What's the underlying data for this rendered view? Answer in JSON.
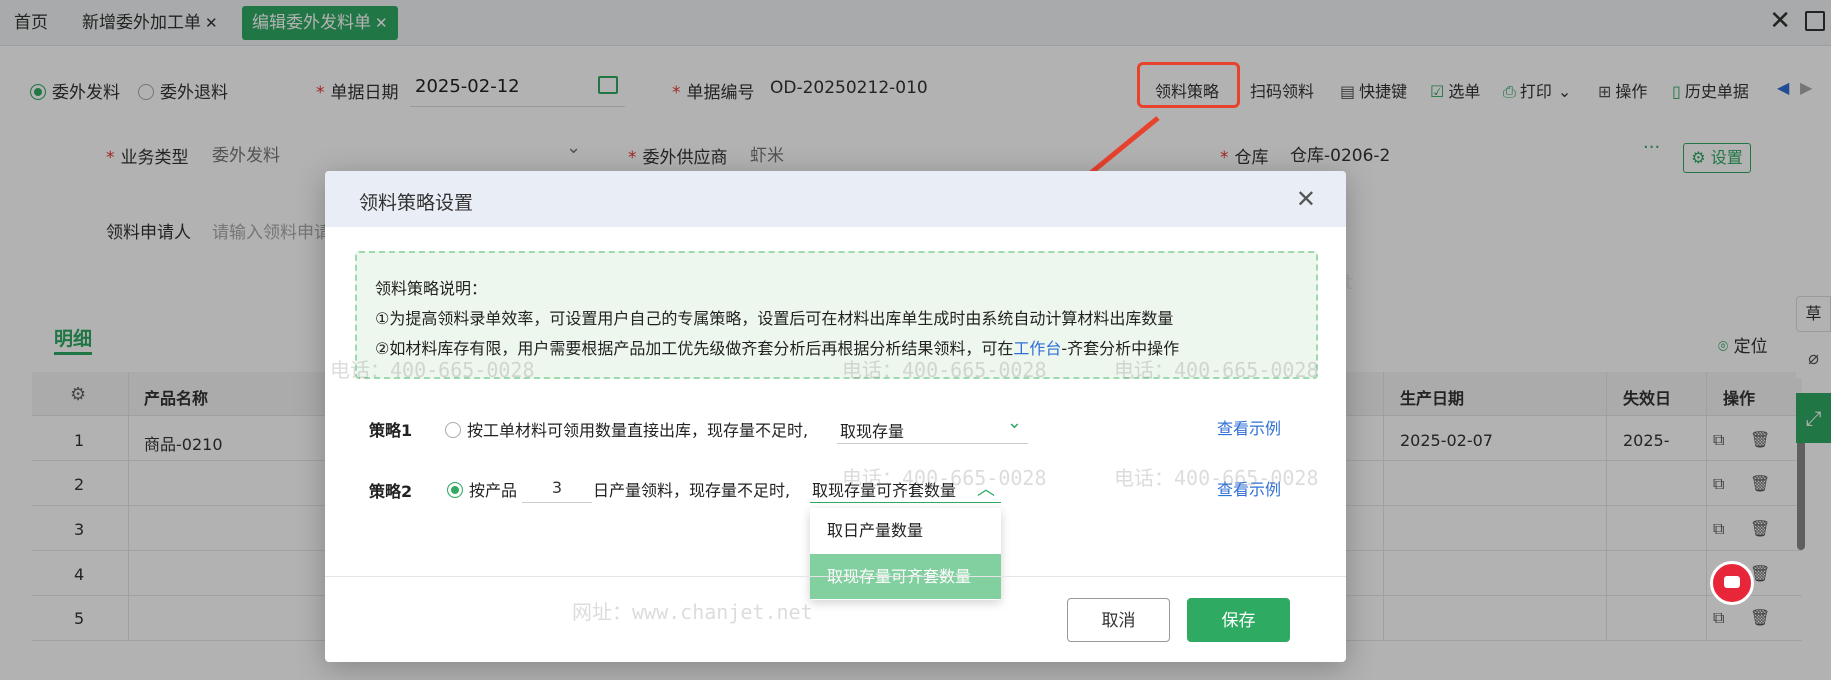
{
  "tabs": [
    {
      "label": "首页",
      "active": false
    },
    {
      "label": "新增委外加工单",
      "active": false,
      "closable": true
    },
    {
      "label": "编辑委外发料单",
      "active": true,
      "closable": true
    }
  ],
  "window": {
    "close_icon": "close-icon",
    "maximize_icon": "maximize-icon"
  },
  "form": {
    "radio_out": "委外发料",
    "radio_return": "委外退料",
    "date_label": "单据日期",
    "date_value": "2025-02-12",
    "docno_label": "单据编号",
    "docno_value": "OD-20250212-010",
    "biztype_label": "业务类型",
    "biztype_value": "委外发料",
    "supplier_label": "委外供应商",
    "supplier_value": "虾米",
    "warehouse_label": "仓库",
    "warehouse_value": "仓库-0206-2",
    "requester_label": "领料申请人",
    "requester_placeholder": "请输入领料申请"
  },
  "toolbar": {
    "strategy": "领料策略",
    "scan": "扫码领料",
    "shortcut": "快捷键",
    "select": "选单",
    "print": "打印",
    "operate": "操作",
    "history": "历史单据",
    "settings": "设置"
  },
  "detail": {
    "tab": "明细",
    "locate": "定位",
    "headers": {
      "name": "产品名称",
      "mfg_date": "生产日期",
      "exp_date": "失效日",
      "op": "操作"
    },
    "rows": [
      {
        "no": "1",
        "name": "商品-0210",
        "mfg": "2025-02-07",
        "exp": "2025-"
      },
      {
        "no": "2",
        "name": "",
        "mfg": "",
        "exp": ""
      },
      {
        "no": "3",
        "name": "",
        "mfg": "",
        "exp": ""
      },
      {
        "no": "4",
        "name": "",
        "mfg": "",
        "exp": ""
      },
      {
        "no": "5",
        "name": "",
        "mfg": "",
        "exp": ""
      }
    ]
  },
  "watermark": {
    "phone": "电话：400-665-0028",
    "site": "网址：www.chanjet.net"
  },
  "modal": {
    "title": "领料策略设置",
    "notice_title": "领料策略说明：",
    "notice_line1": "①为提高领料录单效率，可设置用户自己的专属策略，设置后可在材料出库单生成时由系统自动计算材料出库数量",
    "notice_line2_pre": "②如材料库存有限，用户需要根据产品加工优先级做齐套分析后再根据分析结果领料，可在",
    "notice_line2_link": "工作台",
    "notice_line2_post": "-齐套分析中操作",
    "strategy1_label": "策略1",
    "strategy1_text": "按工单材料可领用数量直接出库，现存量不足时,",
    "strategy1_select": "取现存量",
    "strategy2_label": "策略2",
    "strategy2_pre": "按产品",
    "strategy2_days": "3",
    "strategy2_post": "日产量领料，现存量不足时,",
    "strategy2_select": "取现存量可齐套数量",
    "view_example": "查看示例",
    "dropdown_options": [
      "取日产量数量",
      "取现存量可齐套数量"
    ],
    "cancel": "取消",
    "save": "保存"
  }
}
